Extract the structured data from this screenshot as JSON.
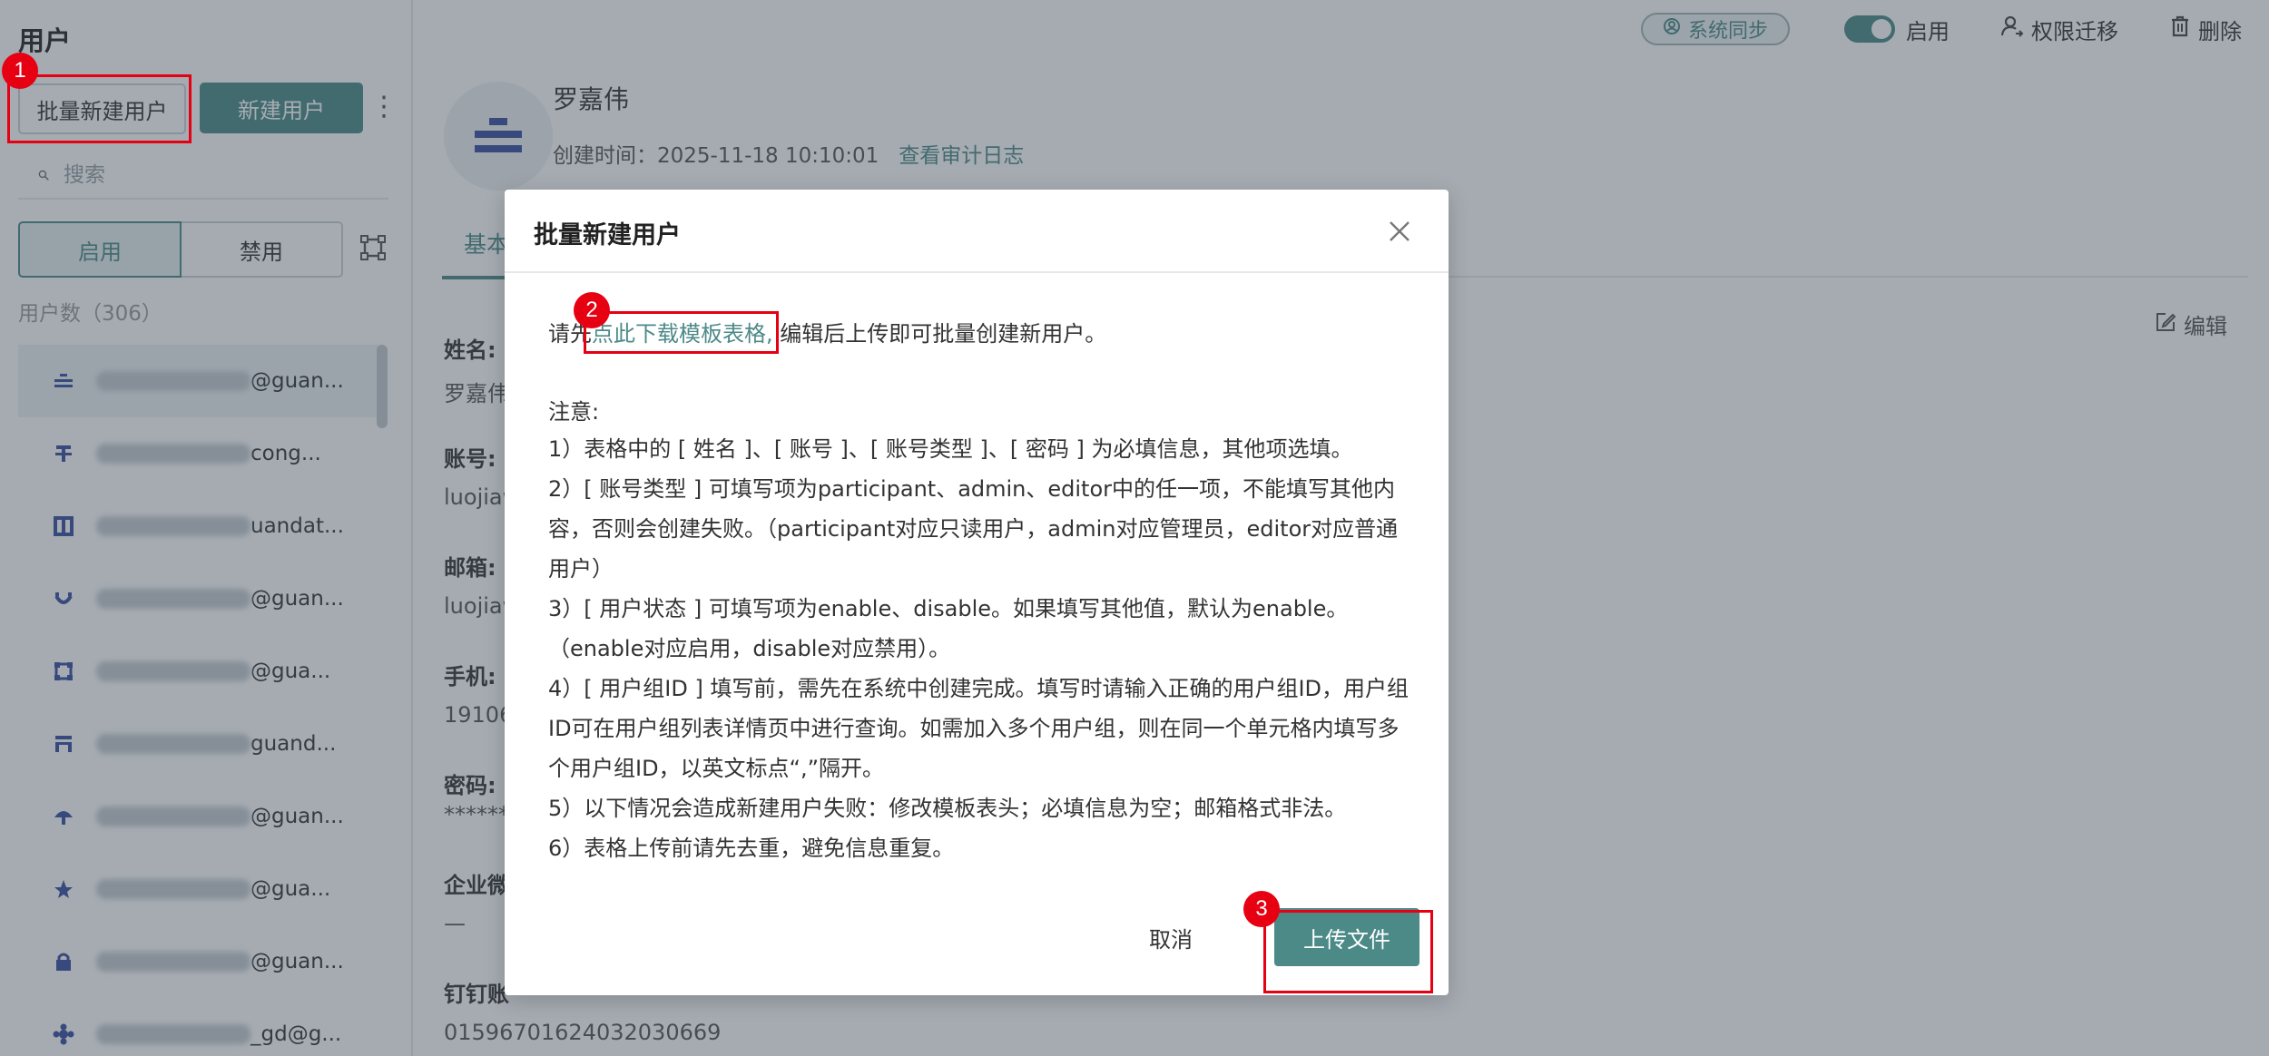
{
  "sidebar": {
    "title": "用户",
    "batch_create_label": "批量新建用户",
    "new_user_label": "新建用户",
    "more_icon": "⋮",
    "search_placeholder": "搜索",
    "tab_enabled": "启用",
    "tab_disabled": "禁用",
    "user_count": "用户数（306）",
    "users": [
      {
        "email_suffix": "@guan...",
        "avatar_icon": "avatar-bars-icon"
      },
      {
        "email_suffix": "cong...",
        "avatar_icon": "avatar-tree-icon"
      },
      {
        "email_suffix": "uandat...",
        "avatar_icon": "avatar-grid-icon"
      },
      {
        "email_suffix": "@guan...",
        "avatar_icon": "avatar-smile-icon"
      },
      {
        "email_suffix": "@gua...",
        "avatar_icon": "avatar-frame-icon"
      },
      {
        "email_suffix": "guand...",
        "avatar_icon": "avatar-stack-icon"
      },
      {
        "email_suffix": "@guan...",
        "avatar_icon": "avatar-umbrella-icon"
      },
      {
        "email_suffix": "@gua...",
        "avatar_icon": "avatar-star-icon"
      },
      {
        "email_suffix": "@guan...",
        "avatar_icon": "avatar-lock-icon"
      },
      {
        "email_suffix": "_gd@g...",
        "avatar_icon": "avatar-flower-icon"
      }
    ]
  },
  "header": {
    "sync_label": "系统同步",
    "enabled_label": "启用",
    "permission_transfer_label": "权限迁移",
    "delete_label": "删除"
  },
  "profile": {
    "name": "罗嘉伟",
    "created_label": "创建时间：",
    "created_value": "2025-11-18 10:10:01",
    "audit_link": "查看审计日志",
    "tab_basic": "基本",
    "edit_label": "编辑",
    "fields": [
      {
        "label": "姓名:",
        "value": "罗嘉伟"
      },
      {
        "label": "账号:",
        "value": "luojiaw"
      },
      {
        "label": "邮箱:",
        "value": "luojiaw"
      },
      {
        "label": "手机:",
        "value": "19106"
      },
      {
        "label": "密码:",
        "value": "******"
      },
      {
        "label": "企业微",
        "value": "—"
      },
      {
        "label": "钉钉账",
        "value": "01596701624032030669"
      }
    ]
  },
  "modal": {
    "title": "批量新建用户",
    "intro_prefix": "请先",
    "intro_link": "点此下载模板表格,",
    "intro_suffix": " 编辑后上传即可批量创建新用户。",
    "notes_title": "注意:",
    "notes": [
      "1）表格中的 [ 姓名 ]、[ 账号 ]、[ 账号类型 ]、[ 密码 ] 为必填信息，其他项选填。",
      "2）[ 账号类型 ] 可填写项为participant、admin、editor中的任一项，不能填写其他内容，否则会创建失败。（participant对应只读用户，admin对应管理员，editor对应普通用户）",
      "3）[ 用户状态 ] 可填写项为enable、disable。如果填写其他值，默认为enable。（enable对应启用，disable对应禁用）。",
      "4）[ 用户组ID ] 填写前，需先在系统中创建完成。填写时请输入正确的用户组ID，用户组ID可在用户组列表详情页中进行查询。如需加入多个用户组，则在同一个单元格内填写多个用户组ID，以英文标点“,”隔开。",
      "5）以下情况会造成新建用户失败：修改模板表头；必填信息为空；邮箱格式非法。",
      "6）表格上传前请先去重，避免信息重复。"
    ],
    "cancel_label": "取消",
    "upload_label": "上传文件"
  },
  "annotations": {
    "step1": "1",
    "step2": "2",
    "step3": "3",
    "color": "#e60012"
  },
  "colors": {
    "accent": "#4c8a88",
    "overlay": "rgba(55,68,82,0.45)"
  }
}
